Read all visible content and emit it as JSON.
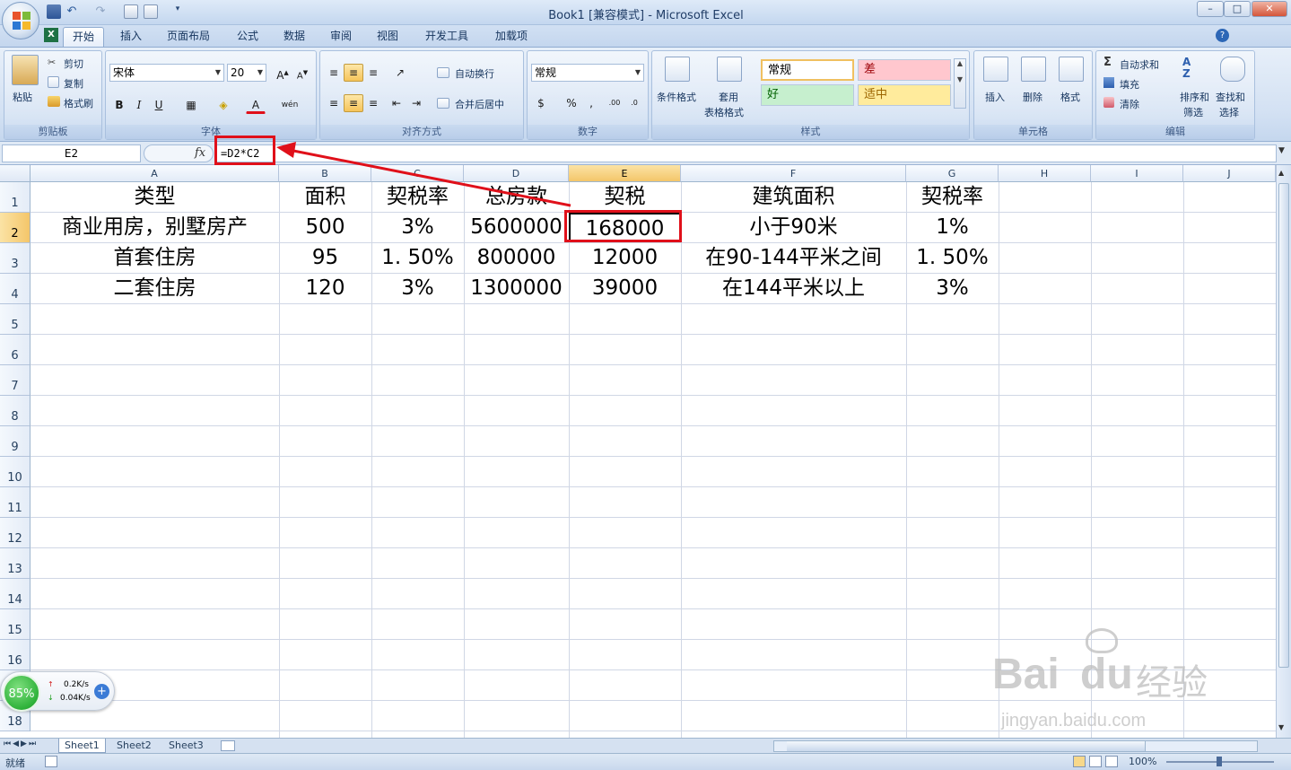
{
  "window": {
    "title": "Book1  [兼容模式] - Microsoft Excel",
    "controls": {
      "minimize": "–",
      "maximize": "□",
      "close": "✕"
    }
  },
  "ribbon_tabs": [
    "开始",
    "插入",
    "页面布局",
    "公式",
    "数据",
    "审阅",
    "视图",
    "开发工具",
    "加载项"
  ],
  "ribbon": {
    "clipboard": {
      "label": "剪贴板",
      "paste": "粘贴",
      "cut": "剪切",
      "copy": "复制",
      "format_painter": "格式刷"
    },
    "font": {
      "label": "字体",
      "name": "宋体",
      "size": "20"
    },
    "alignment": {
      "label": "对齐方式",
      "wrap": "自动换行",
      "merge": "合并后居中"
    },
    "number": {
      "label": "数字",
      "format": "常规"
    },
    "styles": {
      "label": "样式",
      "conditional": "条件格式",
      "table_line1": "套用",
      "table_line2": "表格格式",
      "normal": "常规",
      "bad": "差",
      "good": "好",
      "neutral": "适中"
    },
    "cells": {
      "label": "单元格",
      "insert": "插入",
      "delete": "删除",
      "format": "格式"
    },
    "editing": {
      "label": "编辑",
      "autosum": "自动求和",
      "fill": "填充",
      "clear": "清除",
      "sort1": "排序和",
      "sort2": "筛选",
      "find1": "查找和",
      "find2": "选择"
    }
  },
  "formula_bar": {
    "name_box": "E2",
    "fx": "fx",
    "formula": "=D2*C2"
  },
  "columns": [
    "A",
    "B",
    "C",
    "D",
    "E",
    "F",
    "G",
    "H",
    "I",
    "J"
  ],
  "rows": [
    "1",
    "2",
    "3",
    "4",
    "5",
    "6",
    "7",
    "8",
    "9",
    "10",
    "11",
    "12",
    "13",
    "14",
    "15",
    "16",
    "17",
    "18"
  ],
  "cells": [
    [
      "类型",
      "面积",
      "契税率",
      "总房款",
      "契税",
      "建筑面积",
      "契税率"
    ],
    [
      "商业用房，别墅房产",
      "500",
      "3%",
      "5600000",
      "168000",
      "小于90米",
      "1%"
    ],
    [
      "首套住房",
      "95",
      "1. 50%",
      "800000",
      "12000",
      "在90-144平米之间",
      "1. 50%"
    ],
    [
      "二套住房",
      "120",
      "3%",
      "1300000",
      "39000",
      "在144平米以上",
      "3%"
    ]
  ],
  "sheets": [
    "Sheet1",
    "Sheet2",
    "Sheet3"
  ],
  "status": {
    "ready": "就绪",
    "zoom": "100%"
  },
  "net_widget": {
    "percent": "85%",
    "up": "0.2K/s",
    "down": "0.04K/s"
  },
  "watermark": {
    "brand": "Bai",
    "brand2": "du",
    "cn": "经验",
    "url": "jingyan.baidu.com"
  },
  "colors": {
    "annotation_red": "#e0101a",
    "selected_header": "#f4c66a",
    "ribbon_blue": "#c4d7ee"
  }
}
